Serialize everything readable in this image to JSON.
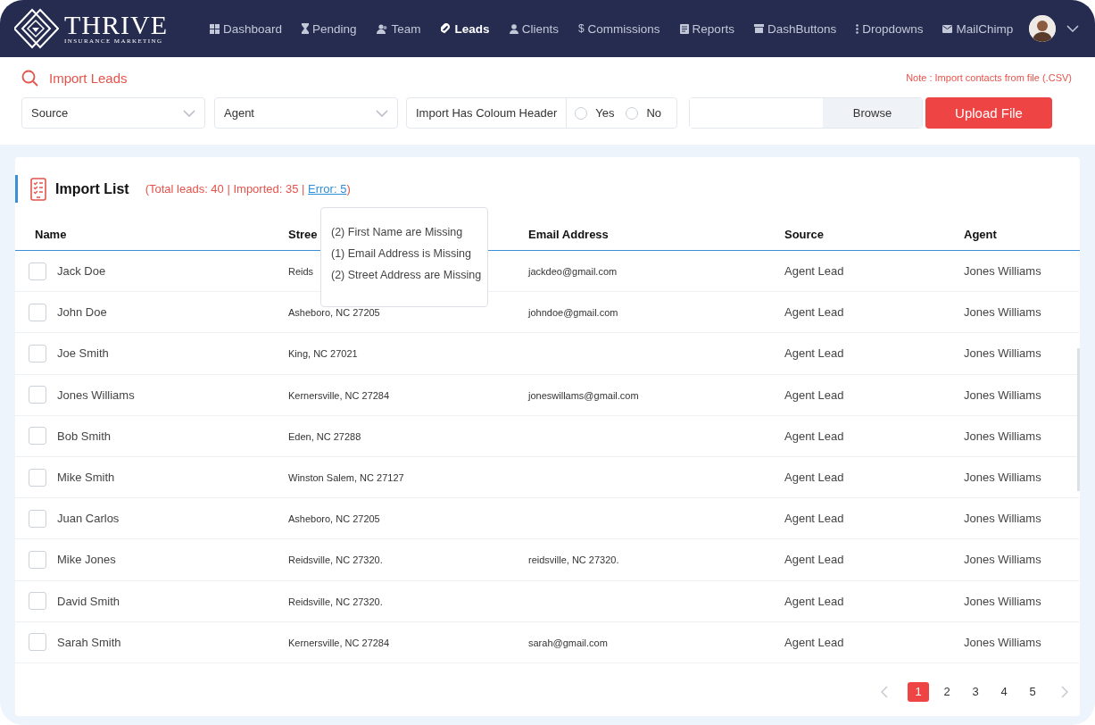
{
  "brand": {
    "name": "THRIVE",
    "tagline": "INSURANCE MARKETING"
  },
  "nav": [
    {
      "label": "Dashboard",
      "selected": false
    },
    {
      "label": "Pending",
      "selected": false
    },
    {
      "label": "Team",
      "selected": false
    },
    {
      "label": "Leads",
      "selected": true
    },
    {
      "label": "Clients",
      "selected": false
    },
    {
      "label": "Commissions",
      "glyph": "$",
      "selected": false
    },
    {
      "label": "Reports",
      "selected": false
    },
    {
      "label": "DashButtons",
      "selected": false
    },
    {
      "label": "Dropdowns",
      "selected": false
    },
    {
      "label": "MailChimp",
      "selected": false
    }
  ],
  "import": {
    "title": "Import Leads",
    "note": "Note : Import contacts from file (.CSV)",
    "source_select": {
      "placeholder": "Source"
    },
    "agent_select": {
      "placeholder": "Agent"
    },
    "header_question": "Import Has Coloum Header",
    "header_options": [
      {
        "label": "Yes",
        "selected": false
      },
      {
        "label": "No",
        "selected": false
      }
    ],
    "browse_button": "Browse",
    "upload_button": "Upload File"
  },
  "import_list": {
    "title": "Import List",
    "summary": "(Total leads: 40 | Imported: 35 | ",
    "error_link": "Error: 5",
    "summary_end": ")",
    "error_tooltip": [
      "(2) First Name are Missing",
      "(1) Email Address is Missing",
      "(2) Street Address are Missing"
    ],
    "columns": [
      "Name",
      "Stree",
      "Email Address",
      "Source",
      "Agent"
    ],
    "rows": [
      {
        "checked": false,
        "name": "Jack Doe",
        "street": "Reids",
        "email": "jackdeo@gmail.com",
        "source": "Agent Lead",
        "agent": "Jones Williams"
      },
      {
        "checked": false,
        "name": "John Doe",
        "street": "Asheboro, NC 27205",
        "email": "johndoe@gmail.com",
        "source": "Agent Lead",
        "agent": "Jones Williams"
      },
      {
        "checked": false,
        "name": "Joe Smith",
        "street": "King, NC 27021",
        "source": "Agent Lead",
        "agent": "Jones Williams"
      },
      {
        "checked": false,
        "name": "Jones Williams",
        "street": "Kernersville, NC 27284",
        "email": "joneswillams@gmail.com",
        "source": "Agent Lead",
        "agent": "Jones Williams"
      },
      {
        "checked": false,
        "name": "Bob Smith",
        "street": "Eden, NC 27288",
        "source": "Agent Lead",
        "agent": "Jones Williams"
      },
      {
        "checked": false,
        "name": "Mike Smith",
        "street": "Winston Salem, NC 27127",
        "source": "Agent Lead",
        "agent": "Jones Williams"
      },
      {
        "checked": false,
        "name": "Juan Carlos",
        "street": "Asheboro, NC 27205",
        "source": "Agent Lead",
        "agent": "Jones Williams"
      },
      {
        "checked": false,
        "name": "Mike Jones",
        "street": "Reidsville, NC 27320.",
        "email": "reidsville, NC 27320.",
        "source": "Agent Lead",
        "agent": "Jones Williams"
      },
      {
        "checked": false,
        "name": "David Smith",
        "street": "Reidsville, NC 27320.",
        "source": "Agent Lead",
        "agent": "Jones Williams"
      },
      {
        "checked": false,
        "name": "Sarah Smith",
        "street": "Kernersville, NC 27284",
        "email": "sarah@gmail.com",
        "source": "Agent Lead",
        "agent": "Jones Williams"
      }
    ],
    "pages": [
      {
        "label": "1",
        "selected": true
      },
      {
        "label": "2",
        "selected": false
      },
      {
        "label": "3",
        "selected": false
      },
      {
        "label": "4",
        "selected": false
      },
      {
        "label": "5",
        "selected": false
      }
    ]
  }
}
